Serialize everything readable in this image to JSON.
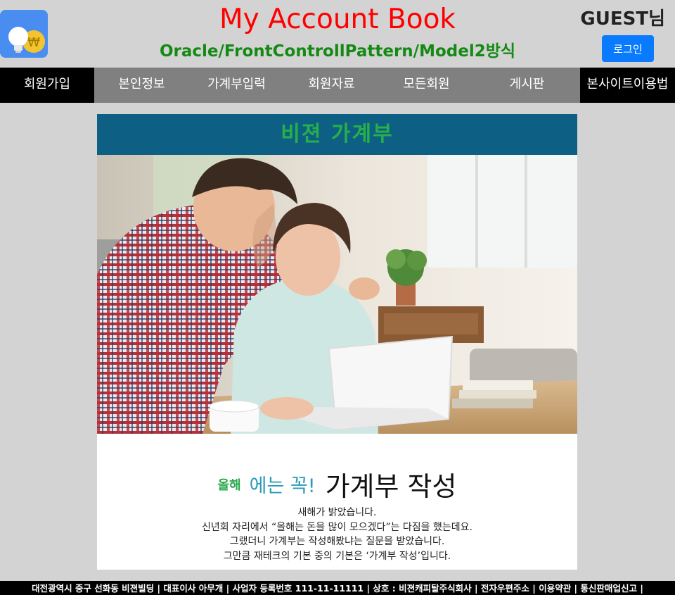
{
  "header": {
    "title": "My Account Book",
    "subtitle": "Oracle/FrontControllPattern/Model2방식",
    "guest_label": "GUEST님",
    "login_label": "로그인",
    "logo_icon": "lightbulb-won-coin-icon",
    "title_color": "#ff0000",
    "subtitle_color": "#148a14",
    "login_color": "#0a7bff"
  },
  "nav": {
    "items": [
      {
        "label": "회원가입"
      },
      {
        "label": "본인정보"
      },
      {
        "label": "가계부입력"
      },
      {
        "label": "회원자료"
      },
      {
        "label": "모든회원"
      },
      {
        "label": "게시판"
      },
      {
        "label": "본사이트이용법"
      }
    ]
  },
  "main": {
    "banner_title": "비젼 가계부",
    "photo_icon": "couple-laptop-photo",
    "promo": {
      "word1": "올해",
      "word2": "에는 꼭!",
      "word3": "가계부 작성",
      "lines": [
        "새해가 밝았습니다.",
        "신년회 자리에서 “올해는 돈을 많이 모으겠다”는 다짐을 했는데요.",
        "그랬더니 가계부는 작성해봤냐는 질문을 받았습니다.",
        "그만큼 재테크의 기본 중의 기본은 ‘가계부 작성’입니다."
      ]
    }
  },
  "footer": {
    "address": "대전광역시 중구 선화동 비젼빌딩",
    "ceo": "대표이사 아무개",
    "biz_no": "사업자 등록번호 111-11-11111",
    "company": "상호 : 비젼캐피탈주식회사",
    "links": [
      "전자우편주소",
      "이용약관",
      "통신판매업신고"
    ]
  }
}
